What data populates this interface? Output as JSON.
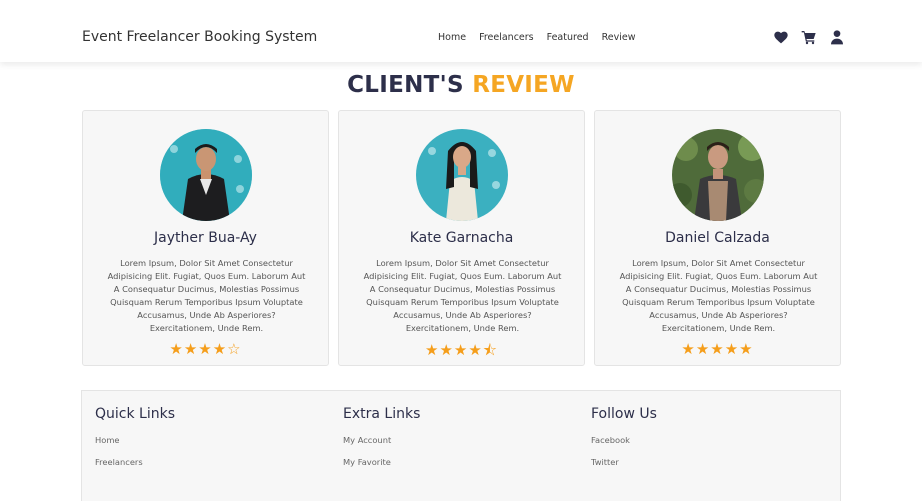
{
  "header": {
    "brand": "Event Freelancer Booking System",
    "nav": [
      "Home",
      "Freelancers",
      "Featured",
      "Review"
    ],
    "icons": [
      "heart-icon",
      "cart-icon",
      "user-icon"
    ]
  },
  "section": {
    "title_part1": "CLIENT'S",
    "title_part2": "REVIEW"
  },
  "reviews": [
    {
      "name": "Jayther Bua-Ay",
      "text": "Lorem Ipsum, Dolor Sit Amet Consectetur Adipisicing Elit. Fugiat, Quos Eum. Laborum Aut A Consequatur Ducimus, Molestias Possimus Quisquam Rerum Temporibus Ipsum Voluptate Accusamus, Unde Ab Asperiores? Exercitationem, Unde Rem.",
      "rating": 4,
      "stars": "★★★★☆"
    },
    {
      "name": "Kate Garnacha",
      "text": "Lorem Ipsum, Dolor Sit Amet Consectetur Adipisicing Elit. Fugiat, Quos Eum. Laborum Aut A Consequatur Ducimus, Molestias Possimus Quisquam Rerum Temporibus Ipsum Voluptate Accusamus, Unde Ab Asperiores? Exercitationem, Unde Rem.",
      "rating": 4.5,
      "stars": "★★★★⯪"
    },
    {
      "name": "Daniel Calzada",
      "text": "Lorem Ipsum, Dolor Sit Amet Consectetur Adipisicing Elit. Fugiat, Quos Eum. Laborum Aut A Consequatur Ducimus, Molestias Possimus Quisquam Rerum Temporibus Ipsum Voluptate Accusamus, Unde Ab Asperiores? Exercitationem, Unde Rem.",
      "rating": 5,
      "stars": "★★★★★"
    }
  ],
  "footer": {
    "quick_links": {
      "title": "Quick Links",
      "links": [
        "Home",
        "Freelancers"
      ]
    },
    "extra_links": {
      "title": "Extra Links",
      "links": [
        "My Account",
        "My Favorite"
      ]
    },
    "follow_us": {
      "title": "Follow Us",
      "links": [
        "Facebook",
        "Twitter"
      ]
    }
  },
  "colors": {
    "primary": "#2d2f4a",
    "accent": "#f5a623",
    "star": "#f59e1b",
    "card_bg": "#f7f7f7"
  }
}
